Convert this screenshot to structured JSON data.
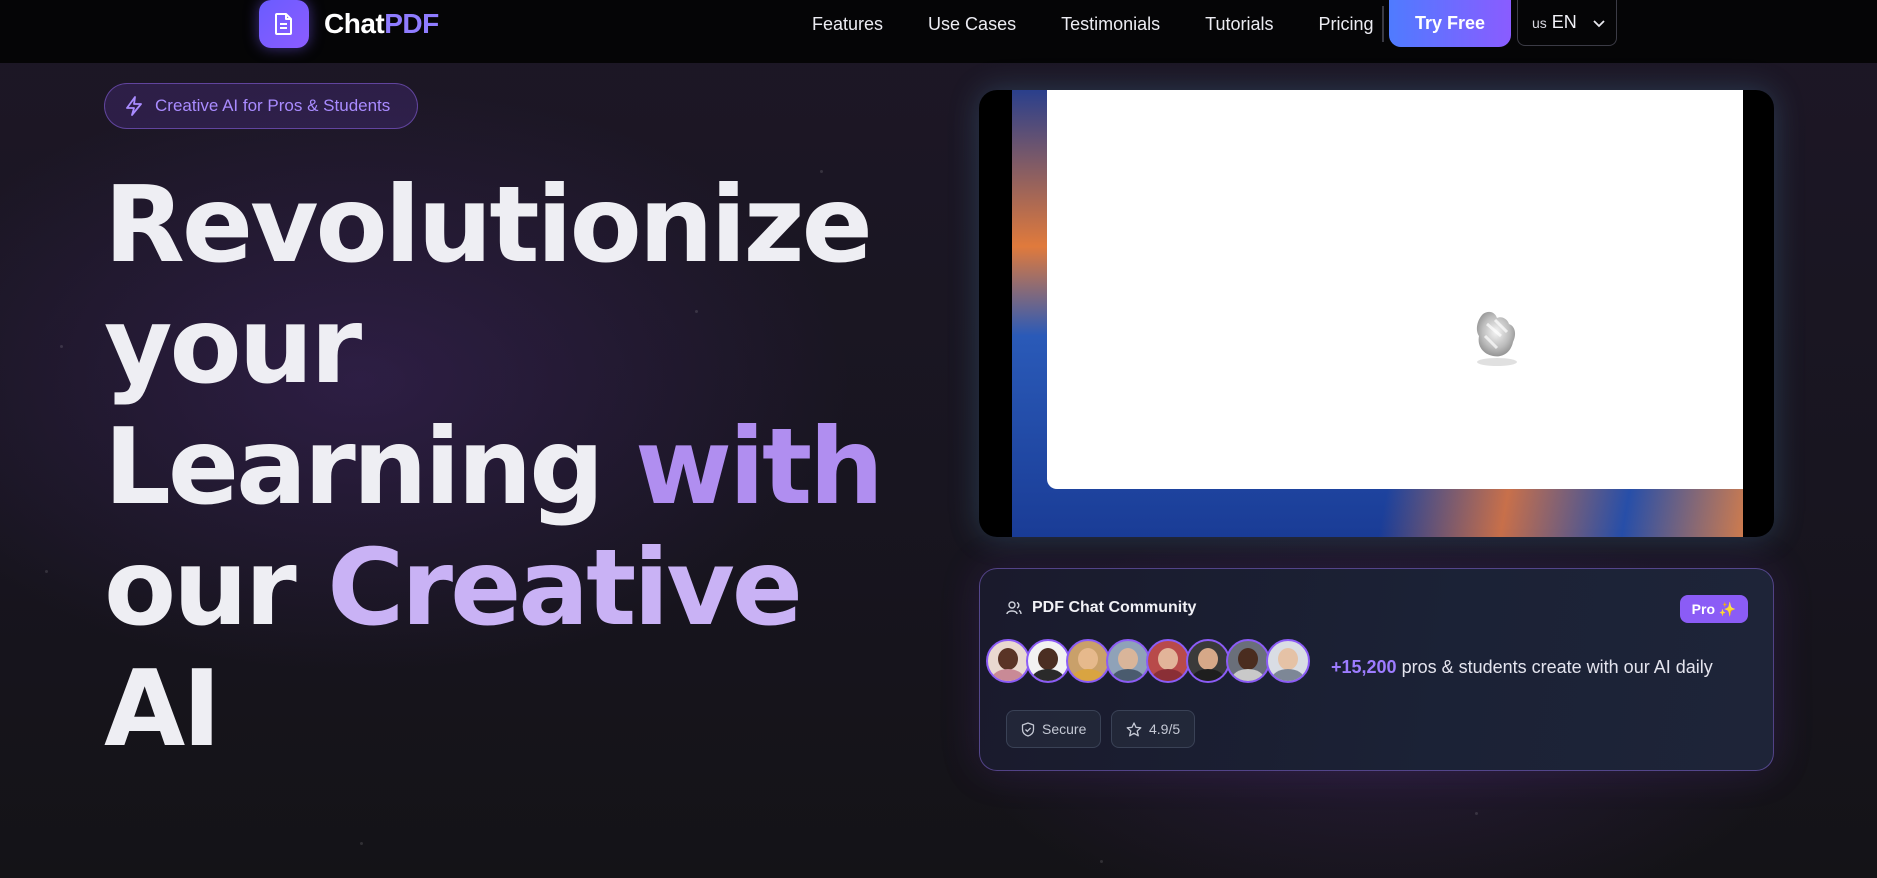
{
  "nav": {
    "logo": {
      "part1": "Chat",
      "part2": "PDF",
      "icon": "document-icon"
    },
    "links": [
      "Features",
      "Use Cases",
      "Testimonials",
      "Tutorials",
      "Pricing"
    ],
    "cta": "Try Free",
    "language": {
      "flag": "us",
      "code": "EN",
      "icon": "chevron-down-icon"
    }
  },
  "hero": {
    "badge": {
      "icon": "lightning-icon",
      "label": "Creative AI for Pros & Students"
    },
    "headline": {
      "line1": "Revolutionize",
      "line2": "your",
      "line3a": "Learning",
      "line3b": "with",
      "line4a": "our",
      "line4b": "Creative",
      "line5": "AI"
    }
  },
  "community": {
    "title": "PDF Chat Community",
    "title_icon": "users-icon",
    "badge": "Pro ✨",
    "count": "+15,200",
    "text": "pros & students create with our AI daily",
    "chips": [
      {
        "icon": "shield-check-icon",
        "label": "Secure"
      },
      {
        "icon": "star-icon",
        "label": "4.9/5"
      }
    ]
  },
  "colors": {
    "accent": "#8b5cf6",
    "cta_start": "#4f7bff",
    "cta_end": "#8a5cff",
    "background": "#141218"
  }
}
